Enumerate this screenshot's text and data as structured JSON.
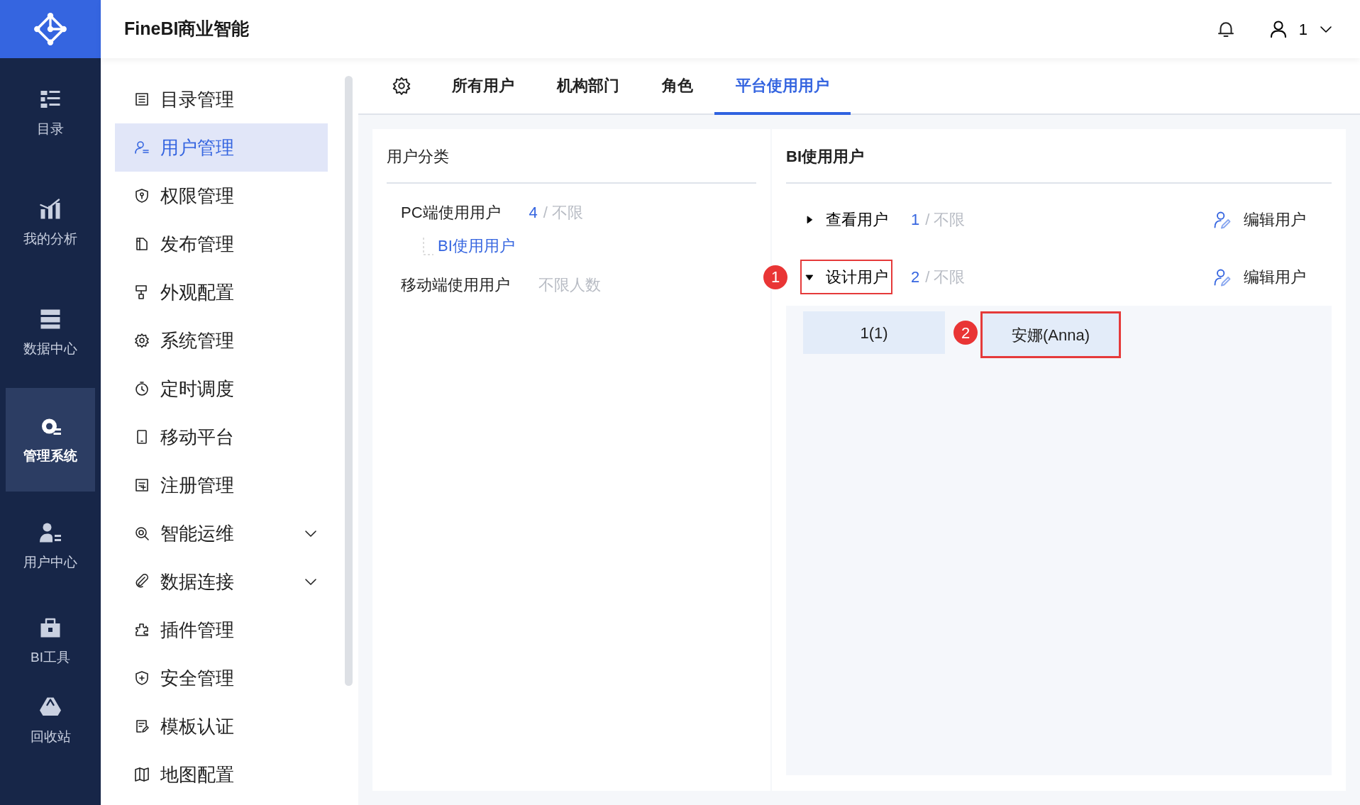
{
  "header": {
    "title": "FineBI商业智能",
    "user": "1"
  },
  "rail": {
    "items": [
      {
        "label": "目录",
        "selected": false
      },
      {
        "label": "我的分析",
        "selected": false
      },
      {
        "label": "数据中心",
        "selected": false
      },
      {
        "label": "管理系统",
        "selected": true
      },
      {
        "label": "用户中心",
        "selected": false
      },
      {
        "label": "BI工具",
        "selected": false
      },
      {
        "label": "回收站",
        "selected": false
      }
    ]
  },
  "menu": {
    "items": [
      {
        "label": "目录管理",
        "selected": false,
        "expandable": false
      },
      {
        "label": "用户管理",
        "selected": true,
        "expandable": false
      },
      {
        "label": "权限管理",
        "selected": false,
        "expandable": false
      },
      {
        "label": "发布管理",
        "selected": false,
        "expandable": false
      },
      {
        "label": "外观配置",
        "selected": false,
        "expandable": false
      },
      {
        "label": "系统管理",
        "selected": false,
        "expandable": false
      },
      {
        "label": "定时调度",
        "selected": false,
        "expandable": false
      },
      {
        "label": "移动平台",
        "selected": false,
        "expandable": false
      },
      {
        "label": "注册管理",
        "selected": false,
        "expandable": false
      },
      {
        "label": "智能运维",
        "selected": false,
        "expandable": true
      },
      {
        "label": "数据连接",
        "selected": false,
        "expandable": true
      },
      {
        "label": "插件管理",
        "selected": false,
        "expandable": false
      },
      {
        "label": "安全管理",
        "selected": false,
        "expandable": false
      },
      {
        "label": "模板认证",
        "selected": false,
        "expandable": false
      },
      {
        "label": "地图配置",
        "selected": false,
        "expandable": false
      }
    ]
  },
  "tabs": [
    {
      "label": "所有用户",
      "selected": false
    },
    {
      "label": "机构部门",
      "selected": false
    },
    {
      "label": "角色",
      "selected": false
    },
    {
      "label": "平台使用用户",
      "selected": true
    }
  ],
  "categories": {
    "title": "用户分类",
    "items": [
      {
        "label": "PC端使用用户",
        "count": "4",
        "quota": "/ 不限",
        "children": [
          {
            "label": "BI使用用户",
            "selected": true
          }
        ]
      },
      {
        "label": "移动端使用用户",
        "quota": "不限人数"
      }
    ]
  },
  "bi_users": {
    "title": "BI使用用户",
    "groups": [
      {
        "label": "查看用户",
        "count": "1",
        "quota": "/ 不限",
        "expanded": false,
        "highlighted": false,
        "action": "编辑用户"
      },
      {
        "label": "设计用户",
        "count": "2",
        "quota": "/ 不限",
        "expanded": true,
        "highlighted": true,
        "callout": "1",
        "action": "编辑用户",
        "departments": [
          {
            "label": "1(1)"
          }
        ],
        "users": [
          {
            "label": "安娜(Anna)",
            "highlighted": true,
            "callout": "2"
          }
        ]
      }
    ]
  }
}
